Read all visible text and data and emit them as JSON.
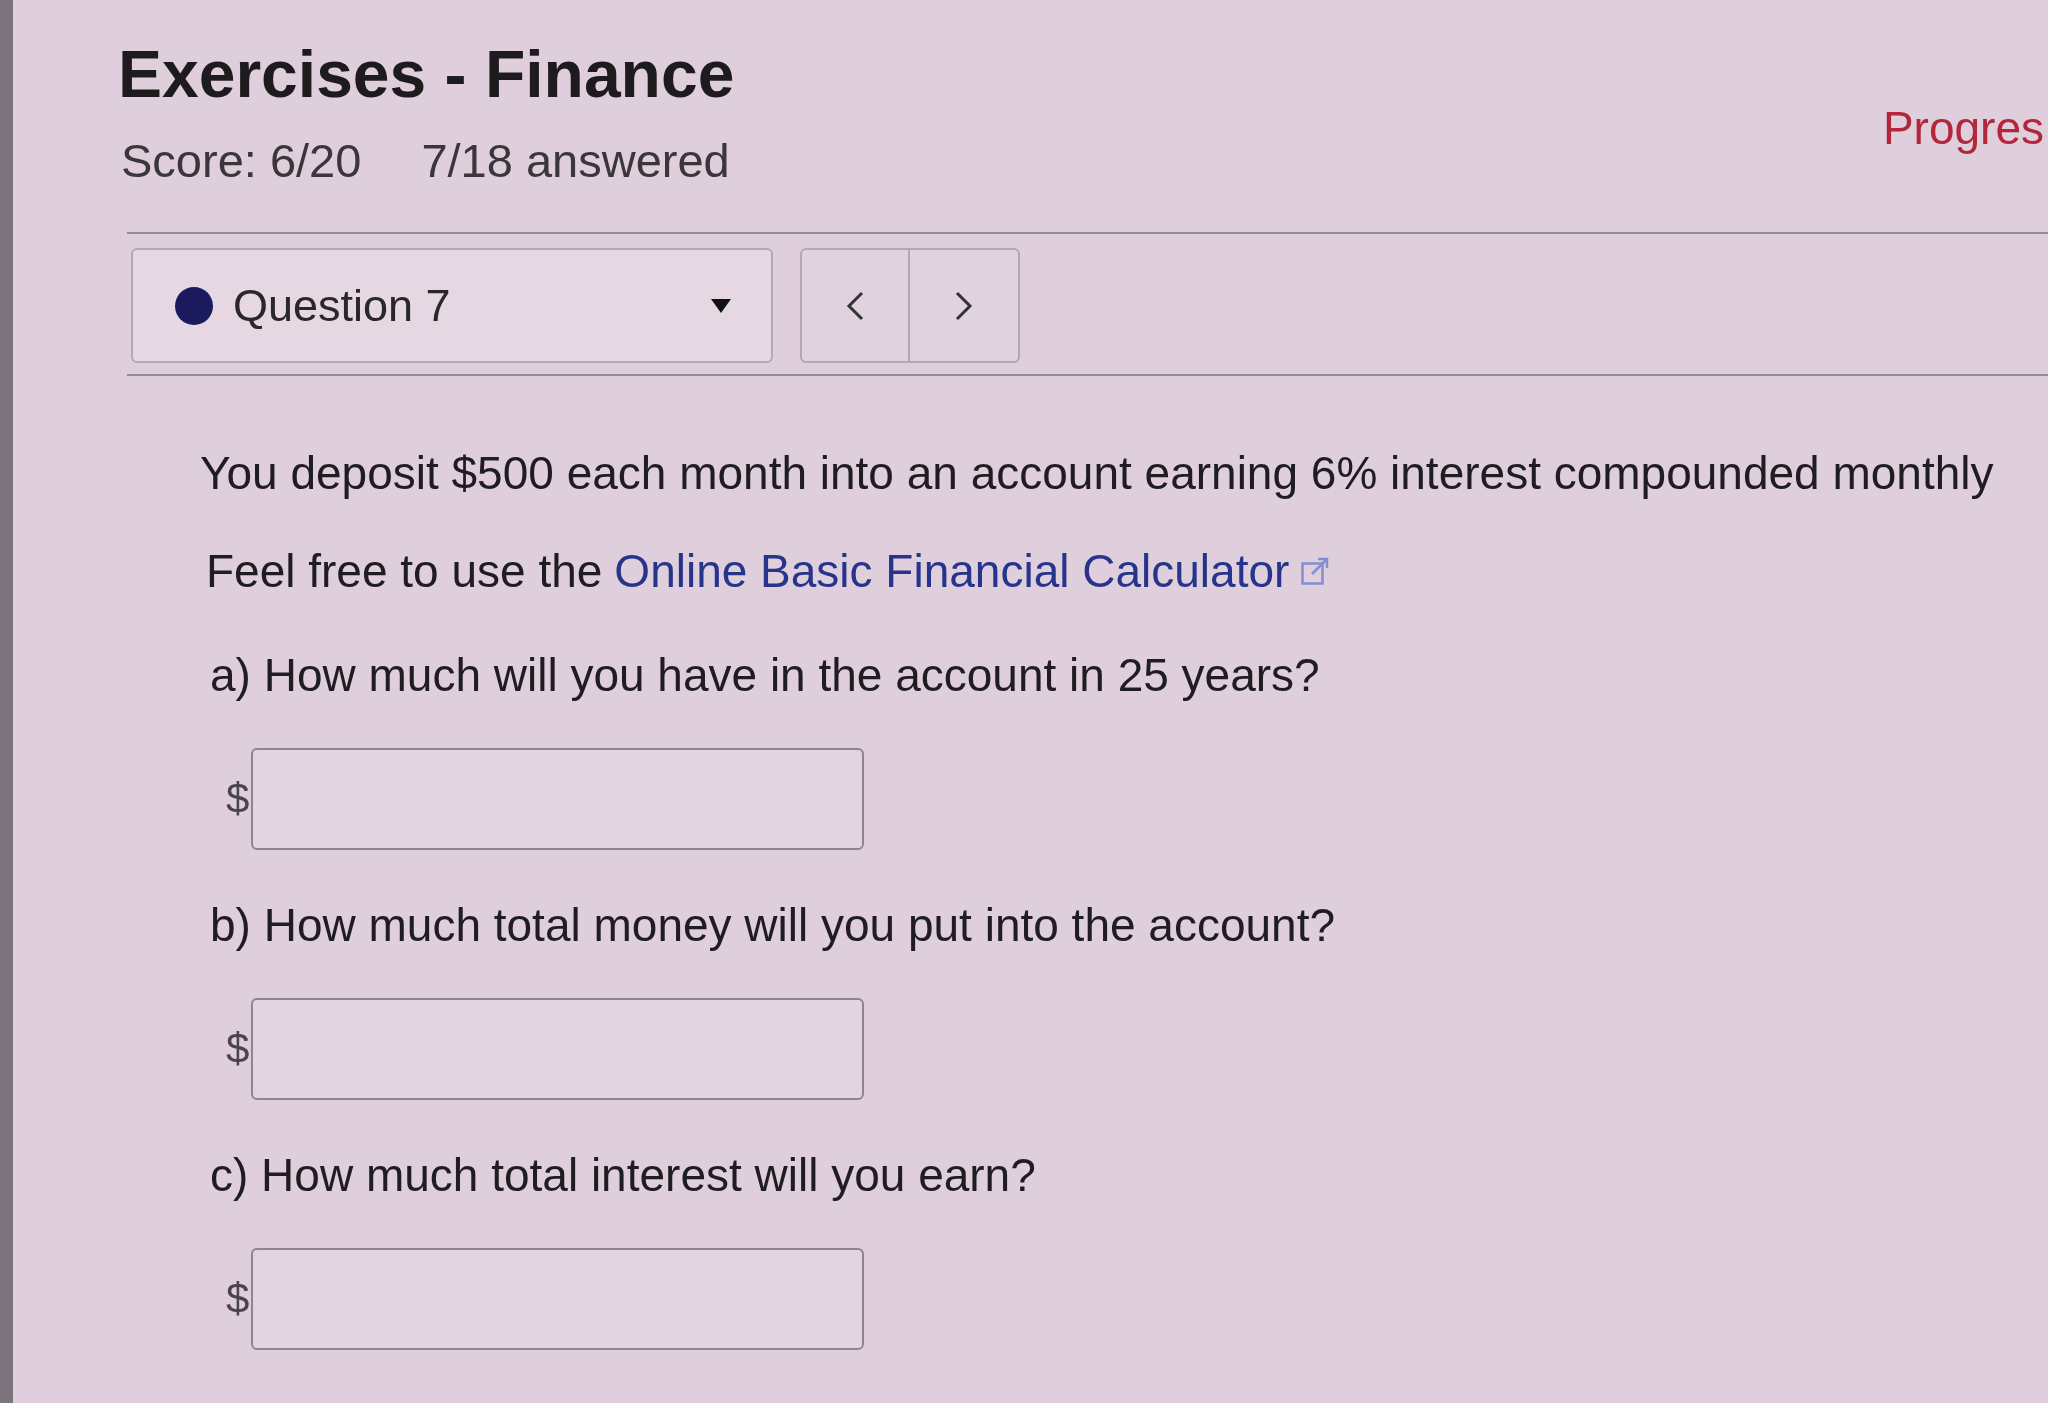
{
  "header": {
    "title": "Exercises - Finance",
    "score": "Score: 6/20",
    "answered": "7/18 answered",
    "progress": "Progres"
  },
  "question_nav": {
    "dropdown": {
      "label": "Question 7"
    }
  },
  "question": {
    "prompt": "You deposit $500 each month into an account earning 6% interest compounded monthly",
    "calculator_note": {
      "text": "Feel free to use the",
      "link": "Online Basic Financial Calculator"
    },
    "parts": [
      {
        "label": "a) How much will you have in the account in 25 years?",
        "prefix": "$"
      },
      {
        "label": "b) How much total money will you put into the account?",
        "prefix": "$"
      },
      {
        "label": "c) How much total interest will you earn?",
        "prefix": "$"
      }
    ]
  }
}
